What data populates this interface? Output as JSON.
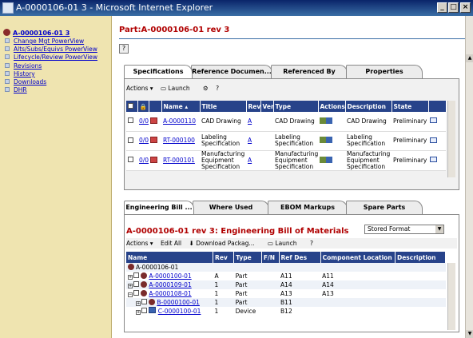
{
  "window": {
    "title": "A-0000106-01 3 - Microsoft Internet Explorer",
    "min": "_",
    "max": "□",
    "close": "×"
  },
  "sidebar": {
    "root": "A-0000106-01 3",
    "items": [
      {
        "label": "Change Mgt PowerView"
      },
      {
        "label": "Alts/Subs/Equivs PowerView"
      },
      {
        "label": "Lifecycle/Review PowerView"
      },
      {
        "label": "Revisions"
      },
      {
        "label": "History"
      },
      {
        "label": "Downloads"
      },
      {
        "label": "DHR"
      }
    ]
  },
  "page": {
    "title": "Part:A-0000106-01 rev 3",
    "help": "?"
  },
  "top_tabs": [
    "Specifications",
    "Reference Documen...",
    "Referenced By",
    "Properties"
  ],
  "spec_toolbar": {
    "actions": "Actions ▾",
    "launch": "Launch"
  },
  "spec_table": {
    "columns": [
      "",
      "",
      "",
      "Name ▴",
      "Title",
      "Rev",
      "Ver",
      "Type",
      "Actions",
      "Description",
      "State",
      ""
    ],
    "rows": [
      {
        "link": "0/0",
        "name": "A-0000110",
        "title": "CAD Drawing",
        "rev": "A",
        "type": "CAD Drawing",
        "description": "CAD Drawing",
        "state": "Preliminary"
      },
      {
        "link": "0/0",
        "name": "RT-000100",
        "title": "Labeling Specification",
        "rev": "A",
        "type": "Labeling Specification",
        "description": "Labeling Specification",
        "state": "Preliminary"
      },
      {
        "link": "0/0",
        "name": "RT-000101",
        "title": "Manufacturing Equipment Specification",
        "rev": "A",
        "type": "Manufacturing Equipment Specification",
        "description": "Manufacturing Equipment Specification",
        "state": "Preliminary"
      }
    ]
  },
  "bottom_tabs": [
    "Engineering Bill ...",
    "Where Used",
    "EBOM Markups",
    "Spare Parts"
  ],
  "ebom": {
    "title": "A-0000106-01 rev 3: Engineering Bill of Materials",
    "format": "Stored Format",
    "toolbar": {
      "actions": "Actions ▾",
      "edit_all": "Edit All",
      "download": "Download Packag...",
      "launch": "Launch"
    },
    "columns": [
      "Name",
      "Rev",
      "Type",
      "F/N",
      "Ref Des",
      "Component Location",
      "Description"
    ],
    "root": "A-0000106-01",
    "rows": [
      {
        "name": "A-0000100-01",
        "rev": "A",
        "type": "Part",
        "fn": "",
        "refdes": "A11",
        "loc": "A11",
        "desc": "",
        "indent": 0
      },
      {
        "name": "A-0000109-01",
        "rev": "1",
        "type": "Part",
        "fn": "",
        "refdes": "A14",
        "loc": "A14",
        "desc": "",
        "indent": 0
      },
      {
        "name": "A-0000108-01",
        "rev": "1",
        "type": "Part",
        "fn": "",
        "refdes": "A13",
        "loc": "A13",
        "desc": "",
        "indent": 0
      },
      {
        "name": "B-0000100-01",
        "rev": "1",
        "type": "Part",
        "fn": "",
        "refdes": "B11",
        "loc": "",
        "desc": "",
        "indent": 1
      },
      {
        "name": "C-0000100-01",
        "rev": "1",
        "type": "Device",
        "fn": "",
        "refdes": "B12",
        "loc": "",
        "desc": "",
        "indent": 1
      }
    ]
  }
}
